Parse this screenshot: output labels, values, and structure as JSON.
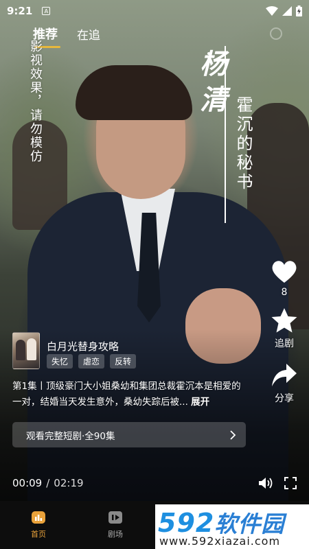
{
  "status_bar": {
    "time": "9:21",
    "badge": "A"
  },
  "tabs": [
    {
      "label": "推荐",
      "active": true
    },
    {
      "label": "在追",
      "active": false
    }
  ],
  "warning_text": "影视效果，请勿模仿",
  "character": {
    "name": "杨清",
    "role": "霍沉的秘书"
  },
  "actions": {
    "like_count": "8",
    "follow_label": "追剧",
    "share_label": "分享"
  },
  "drama": {
    "title": "白月光替身攻略",
    "tags": [
      "失忆",
      "虐恋",
      "反转"
    ],
    "description": "第1集丨顶级豪门大小姐桑幼和集团总裁霍沉本是相爱的一对，结婚当天发生意外，桑幼失踪后被...",
    "expand_label": "展开",
    "watch_full_label": "观看完整短剧·全90集"
  },
  "player": {
    "current_time": "00:09",
    "separator": "/",
    "total_time": "02:19"
  },
  "bottom_nav": [
    {
      "label": "首页",
      "icon": "home-icon",
      "active": true
    },
    {
      "label": "剧场",
      "icon": "theater-icon",
      "active": false
    }
  ],
  "site_logo": {
    "brand_number": "592",
    "brand_name": "软件园",
    "url": "www.592xiazai.com"
  },
  "colors": {
    "accent": "#e9a23b",
    "tab_underline": "#e8b83c",
    "logo_blue": "#1e8fe0"
  }
}
